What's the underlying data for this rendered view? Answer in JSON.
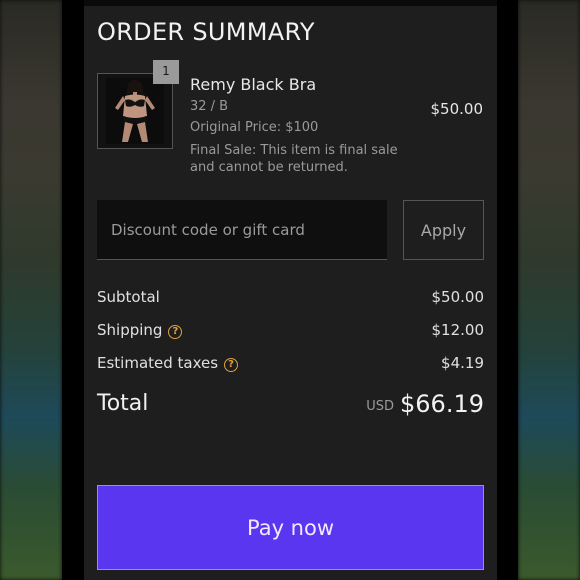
{
  "order_summary": {
    "title": "ORDER SUMMARY",
    "item": {
      "quantity": "1",
      "name": "Remy Black Bra",
      "variant": "32 / B",
      "original_price": "Original Price: $100",
      "note": "Final Sale: This item is final sale and cannot be returned.",
      "price": "$50.00",
      "image_icon": "product-photo"
    },
    "discount": {
      "placeholder": "Discount code or gift card",
      "value": "",
      "apply_label": "Apply"
    },
    "totals": {
      "subtotal_label": "Subtotal",
      "subtotal_value": "$50.00",
      "shipping_label": "Shipping",
      "shipping_value": "$12.00",
      "taxes_label": "Estimated taxes",
      "taxes_value": "$4.19",
      "help_icon": "question-circle-icon",
      "total_label": "Total",
      "currency": "USD",
      "total_value": "$66.19"
    },
    "pay_label": "Pay now"
  },
  "colors": {
    "panel_bg": "#1e1e1e",
    "accent": "#5a36f0",
    "help_icon": "#e0a040",
    "pay_border": "#cf8b5a"
  }
}
